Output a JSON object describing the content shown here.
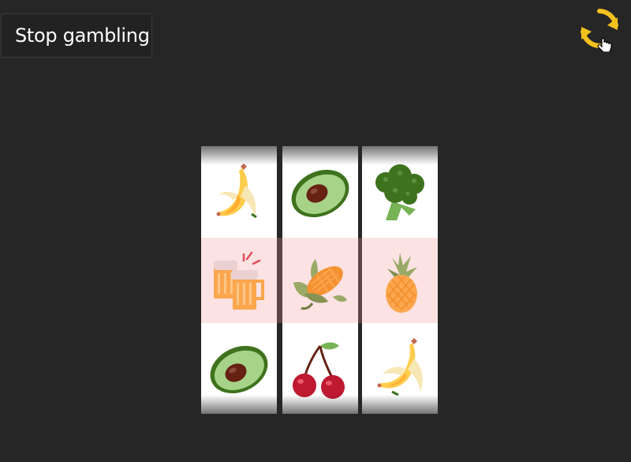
{
  "controls": {
    "stop_label": "Stop gambling",
    "refresh_icon": "refresh-icon"
  },
  "colors": {
    "background": "#262626",
    "refresh_accent": "#f2c11f",
    "win_line": "#f4a0a0"
  },
  "reels": [
    {
      "symbols": [
        "banana",
        "beer",
        "avocado"
      ]
    },
    {
      "symbols": [
        "avocado",
        "corn",
        "cherries"
      ]
    },
    {
      "symbols": [
        "broccoli",
        "pineapple",
        "banana"
      ]
    }
  ]
}
